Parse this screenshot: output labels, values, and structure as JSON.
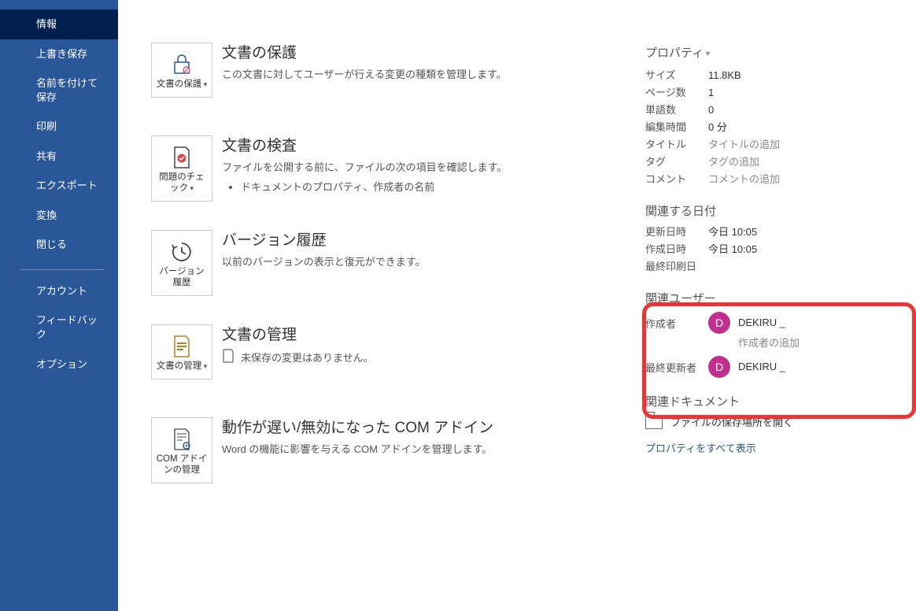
{
  "sidebar": {
    "items": [
      {
        "label": "情報",
        "active": true
      },
      {
        "label": "上書き保存"
      },
      {
        "label": "名前を付けて保存"
      },
      {
        "label": "印刷"
      },
      {
        "label": "共有"
      },
      {
        "label": "エクスポート"
      },
      {
        "label": "変換"
      },
      {
        "label": "閉じる"
      }
    ],
    "footer": [
      {
        "label": "アカウント"
      },
      {
        "label": "フィードバック"
      },
      {
        "label": "オプション"
      }
    ]
  },
  "actions": {
    "protect": {
      "button": "文書の保護",
      "title": "文書の保護",
      "desc": "この文書に対してユーザーが行える変更の種類を管理します。"
    },
    "inspect": {
      "button": "問題のチェック",
      "title": "文書の検査",
      "desc": "ファイルを公開する前に、ファイルの次の項目を確認します。",
      "bullet": "ドキュメントのプロパティ、作成者の名前"
    },
    "history": {
      "button": "バージョン履歴",
      "title": "バージョン履歴",
      "desc": "以前のバージョンの表示と復元ができます。"
    },
    "manage": {
      "button": "文書の管理",
      "title": "文書の管理",
      "desc": "未保存の変更はありません。"
    },
    "com": {
      "button": "COM アドインの管理",
      "title": "動作が遅い/無効になった COM アドイン",
      "desc": "Word の機能に影響を与える COM アドインを管理します。"
    }
  },
  "properties": {
    "header": "プロパティ",
    "size": {
      "label": "サイズ",
      "value": "11.8KB"
    },
    "pages": {
      "label": "ページ数",
      "value": "1"
    },
    "words": {
      "label": "単語数",
      "value": "0"
    },
    "edittime": {
      "label": "編集時間",
      "value": "0 分"
    },
    "title": {
      "label": "タイトル",
      "value": "タイトルの追加"
    },
    "tags": {
      "label": "タグ",
      "value": "タグの追加"
    },
    "comment": {
      "label": "コメント",
      "value": "コメントの追加"
    }
  },
  "dates": {
    "header": "関連する日付",
    "modified": {
      "label": "更新日時",
      "value": "今日 10:05"
    },
    "created": {
      "label": "作成日時",
      "value": "今日 10:05"
    },
    "printed": {
      "label": "最終印刷日",
      "value": ""
    }
  },
  "users": {
    "header": "関連ユーザー",
    "author": {
      "label": "作成者",
      "initial": "D",
      "name": "DEKIRU _",
      "add": "作成者の追加"
    },
    "lastmod": {
      "label": "最終更新者",
      "initial": "D",
      "name": "DEKIRU _"
    }
  },
  "related_docs": {
    "header": "関連ドキュメント",
    "openloc": "ファイルの保存場所を開く"
  },
  "all_props_link": "プロパティをすべて表示"
}
